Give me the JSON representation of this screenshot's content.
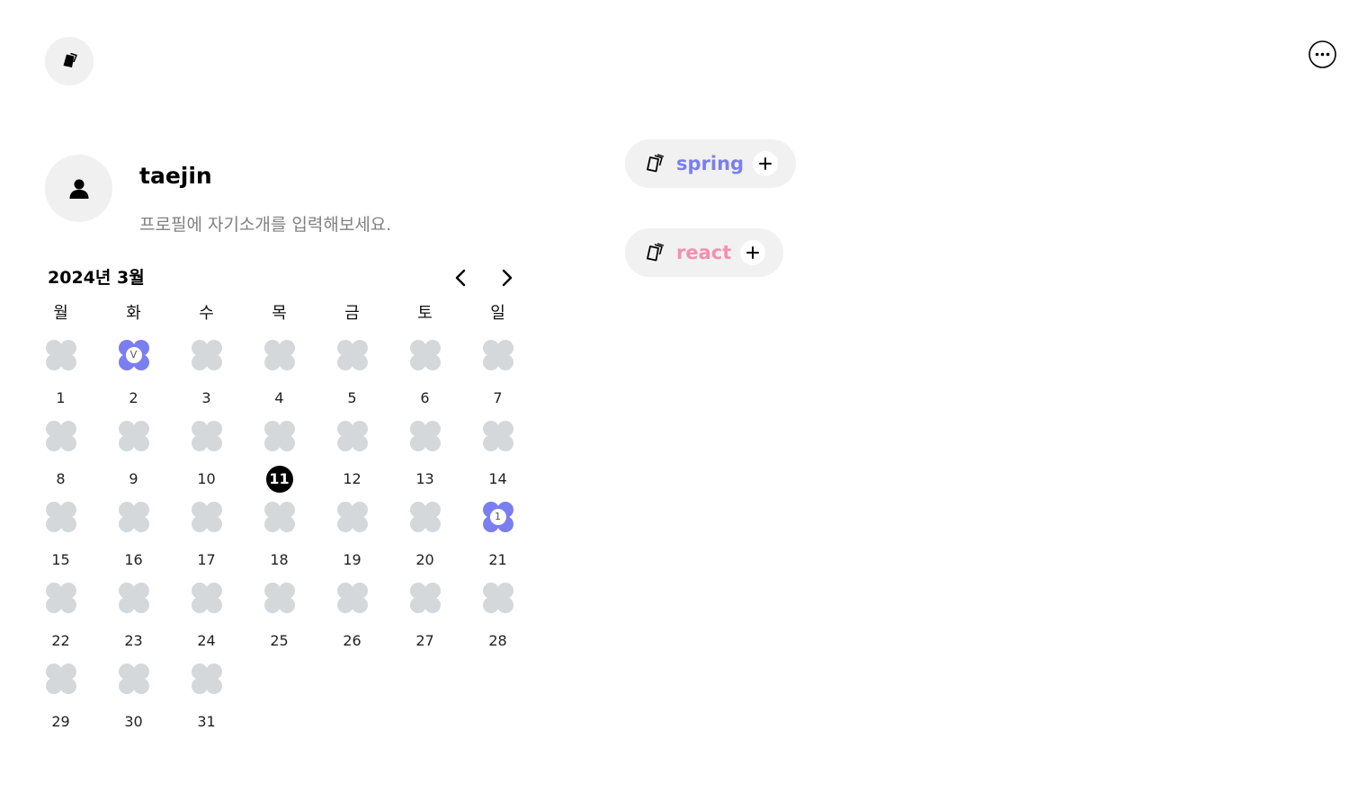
{
  "header": {
    "logo_icon": "cards-icon",
    "more_icon": "more-horizontal-icon"
  },
  "profile": {
    "avatar_icon": "user-icon",
    "username": "taejin",
    "bio_placeholder": "프로필에 자기소개를 입력해보세요."
  },
  "calendar": {
    "title": "2024년 3월",
    "prev_icon": "chevron-left-icon",
    "next_icon": "chevron-right-icon",
    "weekdays": [
      "월",
      "화",
      "수",
      "목",
      "금",
      "토",
      "일"
    ],
    "today": 11,
    "days": [
      {
        "day": "1"
      },
      {
        "day": "2",
        "status": "active",
        "mark": "V"
      },
      {
        "day": "3"
      },
      {
        "day": "4"
      },
      {
        "day": "5"
      },
      {
        "day": "6"
      },
      {
        "day": "7"
      },
      {
        "day": "8"
      },
      {
        "day": "9"
      },
      {
        "day": "10"
      },
      {
        "day": "11"
      },
      {
        "day": "12"
      },
      {
        "day": "13"
      },
      {
        "day": "14"
      },
      {
        "day": "15"
      },
      {
        "day": "16"
      },
      {
        "day": "17"
      },
      {
        "day": "18"
      },
      {
        "day": "19"
      },
      {
        "day": "20"
      },
      {
        "day": "21",
        "status": "active",
        "mark": "1"
      },
      {
        "day": "22"
      },
      {
        "day": "23"
      },
      {
        "day": "24"
      },
      {
        "day": "25"
      },
      {
        "day": "26"
      },
      {
        "day": "27"
      },
      {
        "day": "28"
      },
      {
        "day": "29"
      },
      {
        "day": "30"
      },
      {
        "day": "31"
      }
    ]
  },
  "tags": [
    {
      "label": "spring",
      "color": "#7b7ef0",
      "icon": "cards-icon",
      "add_icon": "plus-icon"
    },
    {
      "label": "react",
      "color": "#f48fb1",
      "icon": "cards-icon",
      "add_icon": "plus-icon"
    }
  ],
  "colors": {
    "flower_empty": "#d5d8db",
    "flower_active": "#7b7ef0",
    "today_bg": "#000000",
    "pill_bg": "#f1f1f1"
  }
}
